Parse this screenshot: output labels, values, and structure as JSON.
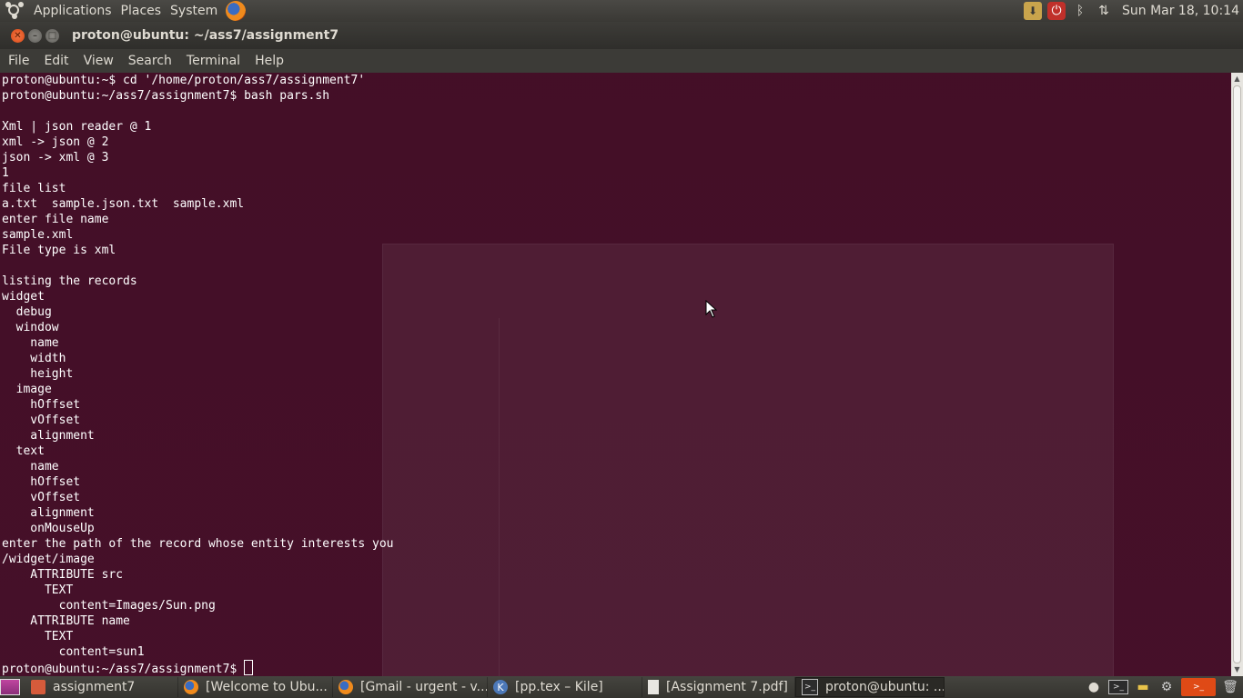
{
  "top_panel": {
    "menus": [
      "Applications",
      "Places",
      "System"
    ],
    "clock": "Sun Mar 18, 10:14"
  },
  "window": {
    "title": "proton@ubuntu: ~/ass7/assignment7",
    "menu": [
      "File",
      "Edit",
      "View",
      "Search",
      "Terminal",
      "Help"
    ]
  },
  "terminal": {
    "lines": [
      "proton@ubuntu:~$ cd '/home/proton/ass7/assignment7'",
      "proton@ubuntu:~/ass7/assignment7$ bash pars.sh",
      "",
      "Xml | json reader @ 1",
      "xml -> json @ 2",
      "json -> xml @ 3",
      "1",
      "file list",
      "a.txt  sample.json.txt  sample.xml",
      "enter file name",
      "sample.xml",
      "File type is xml",
      "",
      "listing the records",
      "widget",
      "  debug",
      "  window",
      "    name",
      "    width",
      "    height",
      "  image",
      "    hOffset",
      "    vOffset",
      "    alignment",
      "  text",
      "    name",
      "    hOffset",
      "    vOffset",
      "    alignment",
      "    onMouseUp",
      "enter the path of the record whose entity interests you",
      "/widget/image",
      "    ATTRIBUTE src",
      "      TEXT",
      "        content=Images/Sun.png",
      "    ATTRIBUTE name",
      "      TEXT",
      "        content=sun1"
    ],
    "prompt": "proton@ubuntu:~/ass7/assignment7$ "
  },
  "taskbar": {
    "tasks": [
      {
        "label": "assignment7",
        "icon": "folder-icon"
      },
      {
        "label": "[Welcome to Ubu...",
        "icon": "firefox-icon"
      },
      {
        "label": "[Gmail - urgent - v...",
        "icon": "firefox-icon"
      },
      {
        "label": "[pp.tex – Kile]",
        "icon": "kile-icon"
      },
      {
        "label": "[Assignment 7.pdf]",
        "icon": "document-icon"
      },
      {
        "label": "proton@ubuntu: ...",
        "icon": "terminal-icon",
        "active": true
      }
    ]
  },
  "colors": {
    "terminal_bg": "#460c28",
    "panel_bg": "#3c3b37",
    "close_button": "#df4a16"
  }
}
